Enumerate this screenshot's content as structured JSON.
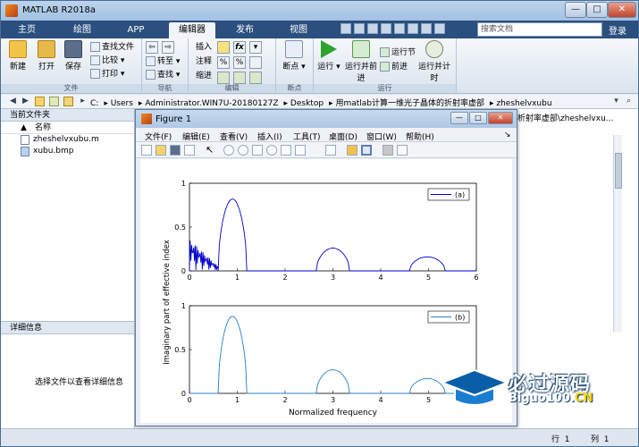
{
  "window": {
    "title": "MATLAB R2018a",
    "min": "—",
    "max": "□",
    "close": "✕"
  },
  "tabs": [
    "主页",
    "绘图",
    "APP",
    "编辑器",
    "发布",
    "视图"
  ],
  "active_tab": "编辑器",
  "search": {
    "placeholder": "搜索文档"
  },
  "login": "登录",
  "ribbon": {
    "file_group": {
      "label": "文件",
      "new": "新建",
      "open": "打开",
      "save": "保存",
      "find_files": "查找文件",
      "compare": "比较",
      "print": "打印"
    },
    "nav_group": {
      "label": "导航",
      "goto": "转至",
      "find": "查找"
    },
    "edit_group": {
      "label": "编辑",
      "insert": "插入",
      "comment": "注释",
      "indent": "缩进",
      "fx": "fx"
    },
    "breakpoint_group": {
      "label": "断点",
      "breakpoints": "断点"
    },
    "run_group": {
      "label": "运行",
      "run": "运行",
      "run_advance": "运行并前进",
      "run_section": "运行节",
      "advance": "前进",
      "run_time": "运行并计时"
    }
  },
  "address": {
    "segments": [
      "C:",
      "Users",
      "Administrator.WIN7U-20180127Z",
      "Desktop",
      "用matlab计算一维光子晶体的折射率虚部",
      "zheshelvxubu"
    ],
    "right_path": "析射率虚部\\zheshelvxu..."
  },
  "folder_panel": {
    "title": "当前文件夹",
    "column": "名称",
    "files": [
      "zheshelvxubu.m",
      "xubu.bmp"
    ]
  },
  "details_panel": {
    "title": "详细信息",
    "message": "选择文件以查看详细信息"
  },
  "status": {
    "row_label": "行",
    "row_value": "1",
    "col_label": "列",
    "col_value": "1"
  },
  "figure": {
    "title": "Figure 1",
    "menu": [
      "文件(F)",
      "编辑(E)",
      "查看(V)",
      "插入(I)",
      "工具(T)",
      "桌面(D)",
      "窗口(W)",
      "帮助(H)"
    ]
  },
  "watermark": {
    "line1": "必过源码",
    "line2_main": "Biguo100.",
    "line2_cn": "CN"
  },
  "chart_data": [
    {
      "type": "line",
      "legend": [
        "(a)"
      ],
      "legend_position": "top-right",
      "xlim": [
        0,
        6
      ],
      "ylim": [
        0,
        1
      ],
      "xticks": [
        0,
        1,
        2,
        3,
        4,
        5,
        6
      ],
      "yticks": [
        0,
        0.5,
        1
      ],
      "series": [
        {
          "name": "(a)",
          "color": "#0000cc",
          "arcs": [
            {
              "x0": 0.6,
              "x1": 1.2,
              "peak": 0.82
            },
            {
              "x0": 2.65,
              "x1": 3.35,
              "peak": 0.26
            },
            {
              "x0": 4.6,
              "x1": 5.35,
              "peak": 0.16
            }
          ],
          "oscillation": {
            "x0": 0.0,
            "x1": 0.6,
            "start": 0.36,
            "end": 0.05
          }
        }
      ]
    },
    {
      "type": "line",
      "legend": [
        "(b)"
      ],
      "legend_position": "top-right",
      "xlabel": "Normalized frequency",
      "ylabel": "Imaginary part of effective index",
      "xlim": [
        0,
        6
      ],
      "ylim": [
        0,
        1
      ],
      "xticks": [
        0,
        1,
        2,
        3,
        4,
        5,
        6
      ],
      "yticks": [
        0,
        0.5,
        1
      ],
      "series": [
        {
          "name": "(b)",
          "color": "#2a7fc4",
          "arcs": [
            {
              "x0": 0.6,
              "x1": 1.2,
              "peak": 0.88
            },
            {
              "x0": 2.65,
              "x1": 3.35,
              "peak": 0.27
            },
            {
              "x0": 4.6,
              "x1": 5.35,
              "peak": 0.17
            }
          ]
        }
      ]
    }
  ]
}
